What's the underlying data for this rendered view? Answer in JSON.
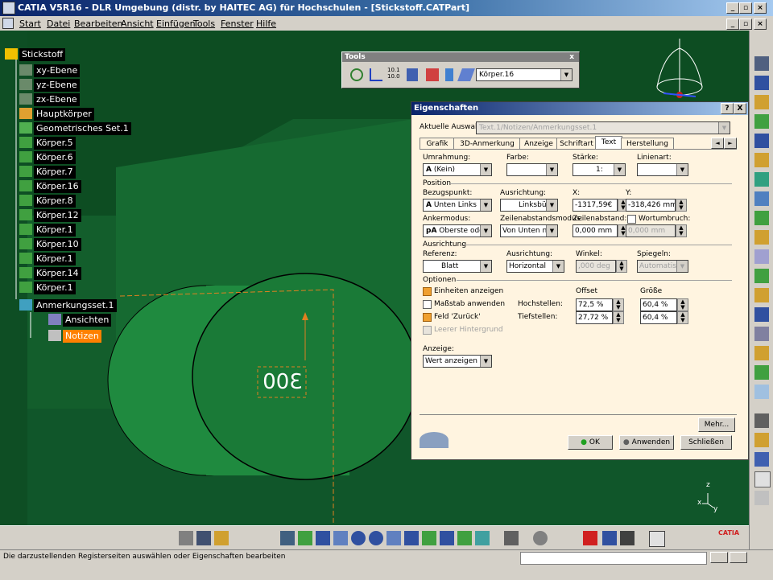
{
  "window": {
    "title": "CATIA V5R16 - DLR Umgebung (distr. by HAITEC AG) für Hochschulen - [Stickstoff.CATPart]",
    "controls": [
      "_",
      "▫",
      "×"
    ]
  },
  "menubar": {
    "items": [
      "Start",
      "Datei",
      "Bearbeiten",
      "Ansicht",
      "Einfügen",
      "Tools",
      "Fenster",
      "Hilfe"
    ]
  },
  "tree": {
    "root": "Stickstoff",
    "items": [
      "xy-Ebene",
      "yz-Ebene",
      "zx-Ebene",
      "Hauptkörper",
      "Geometrisches Set.1",
      "Körper.5",
      "Körper.6",
      "Körper.7",
      "Körper.16",
      "Körper.8",
      "Körper.12",
      "Körper.1",
      "Körper.10",
      "Körper.1",
      "Körper.14",
      "Körper.1",
      "Anmerkungsset.1",
      "Ansichten",
      "Notizen"
    ]
  },
  "tools_toolbar": {
    "title": "Tools",
    "close": "x",
    "combo_value": "Körper.16",
    "units_label_top": "10.1",
    "units_label_bottom": "10.0"
  },
  "annotation": {
    "text": "300"
  },
  "compass_axes": {
    "z": "z",
    "x": "x",
    "y": "y"
  },
  "dialog": {
    "title": "Eigenschaften",
    "help": "?",
    "close": "X",
    "current_selection_label": "Aktuelle Auswahl:",
    "current_selection_value": "Text.1/Notizen/Anmerkungsset.1",
    "tabs": [
      "Grafik",
      "3D-Anmerkung",
      "Anzeige",
      "Schriftart",
      "Text",
      "Herstellung"
    ],
    "active_tab": "Text",
    "tab_nav": [
      "◄",
      "►"
    ],
    "umrahmung": {
      "label": "Umrahmung:",
      "value": "(Kein)",
      "icon": "A"
    },
    "farbe": {
      "label": "Farbe:",
      "value": ""
    },
    "staerke": {
      "label": "Stärke:",
      "value": "1:"
    },
    "linienart": {
      "label": "Linienart:",
      "value": ""
    },
    "position_section": "Position",
    "bezugspunkt": {
      "label": "Bezugspunkt:",
      "value": "Unten Links",
      "icon": "A"
    },
    "ausrichtung1": {
      "label": "Ausrichtung:",
      "value": "Linksbün"
    },
    "x": {
      "label": "X:",
      "value": "-1317,59€"
    },
    "y": {
      "label": "Y:",
      "value": "-318,426 mm"
    },
    "ankermodus": {
      "label": "Ankermodus:",
      "value": "Oberste ode",
      "icon": "pA"
    },
    "zeilenabstandsmodus": {
      "label": "Zeilenabstandsmodus:",
      "value": "Von Unten nac"
    },
    "zeilenabstand": {
      "label": "Zeilenabstand:",
      "value": "0,000 mm"
    },
    "wortumbruch": {
      "label": "Wortumbruch:",
      "value": "0,000 mm",
      "checked": false
    },
    "ausrichtung_section": "Ausrichtung",
    "referenz": {
      "label": "Referenz:",
      "value": "Blatt"
    },
    "ausrichtung2": {
      "label": "Ausrichtung:",
      "value": "Horizontal"
    },
    "winkel": {
      "label": "Winkel:",
      "value": ",000 deg"
    },
    "spiegeln": {
      "label": "Spiegeln:",
      "value": "Automatisch"
    },
    "optionen_section": "Optionen",
    "einheiten": {
      "label": "Einheiten anzeigen",
      "checked": true
    },
    "massstab": {
      "label": "Maßstab anwenden",
      "checked": false
    },
    "feld_zurueck": {
      "label": "Feld 'Zurück'",
      "checked": true
    },
    "leerer_hintergrund": {
      "label": "Leerer Hintergrund",
      "checked": false
    },
    "offset_label": "Offset",
    "groesse_label": "Größe",
    "hochstellen": {
      "label": "Hochstellen:",
      "offset": "72,5 %",
      "size": "60,4 %"
    },
    "tiefstellen": {
      "label": "Tiefstellen:",
      "offset": "27,72 %",
      "size": "60,4 %"
    },
    "anzeige": {
      "label": "Anzeige:",
      "value": "Wert anzeigen"
    },
    "more_button": "Mehr...",
    "ok_button": "OK",
    "apply_button": "Anwenden",
    "close_button": "Schließen"
  },
  "statusbar": {
    "text": "Die darzustellenden Registerseiten auswählen oder Eigenschaften bearbeiten"
  },
  "catia_logo": "CATIA",
  "colors": {
    "viewport_green": "#135e2c",
    "part_green": "#1f8a3f",
    "tree_highlight": "#ff8000",
    "dialog_bg": "#fff4e0"
  }
}
